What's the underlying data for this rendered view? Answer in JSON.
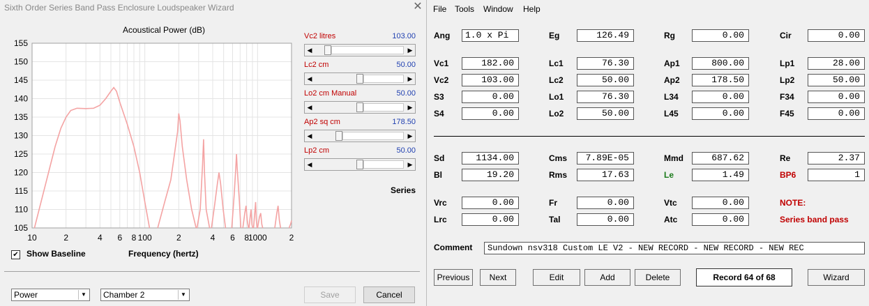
{
  "wizard": {
    "title": "Sixth Order Series Band Pass Enclosure Loudspeaker Wizard",
    "close_glyph": "✕",
    "chart_title": "Acoustical Power (dB)",
    "x_axis_label": "Frequency (hertz)",
    "sliders": [
      {
        "label": "Vc2 litres",
        "value": "103.00",
        "thumb": 0.1
      },
      {
        "label": "Lc2 cm",
        "value": "50.00",
        "thumb": 0.5
      },
      {
        "label": "Lo2 cm Manual",
        "value": "50.00",
        "thumb": 0.5
      },
      {
        "label": "Ap2 sq cm",
        "value": "178.50",
        "thumb": 0.24
      },
      {
        "label": "Lp2 cm",
        "value": "50.00",
        "thumb": 0.5
      }
    ],
    "series_label": "Series",
    "show_baseline_label": "Show Baseline",
    "show_baseline_checked": true,
    "combo_mode": "Power",
    "combo_chamber": "Chamber 2",
    "save_label": "Save",
    "cancel_label": "Cancel"
  },
  "chart_data": {
    "type": "line",
    "title": "Acoustical Power (dB)",
    "xlabel": "Frequency (hertz)",
    "ylabel": "",
    "x_scale": "log",
    "xlim": [
      10,
      2000
    ],
    "ylim": [
      105,
      155
    ],
    "yticks": [
      105,
      110,
      115,
      120,
      125,
      130,
      135,
      140,
      145,
      150,
      155
    ],
    "xtick_labels": [
      "10",
      "2",
      "4",
      "6",
      "8",
      "100",
      "2",
      "4",
      "6",
      "8",
      "1000",
      "2"
    ],
    "xtick_values": [
      10,
      20,
      40,
      60,
      80,
      100,
      200,
      400,
      600,
      800,
      1000,
      2000
    ],
    "grid": true,
    "series": [
      {
        "color": "#f4a3a3",
        "points": [
          [
            10.5,
            105
          ],
          [
            12,
            112
          ],
          [
            14,
            120
          ],
          [
            16,
            127
          ],
          [
            18,
            132
          ],
          [
            20,
            135
          ],
          [
            22,
            136.8
          ],
          [
            25,
            137.4
          ],
          [
            30,
            137.3
          ],
          [
            35,
            137.4
          ],
          [
            40,
            138.2
          ],
          [
            45,
            140
          ],
          [
            50,
            142
          ],
          [
            53,
            143
          ],
          [
            56,
            142
          ],
          [
            60,
            139
          ],
          [
            70,
            133
          ],
          [
            80,
            127
          ],
          [
            90,
            120
          ],
          [
            100,
            112
          ],
          [
            110,
            105
          ]
        ]
      },
      {
        "color": "#f4a3a3",
        "points": [
          [
            130,
            105
          ],
          [
            150,
            112
          ],
          [
            170,
            118
          ],
          [
            185,
            126
          ],
          [
            195,
            131
          ],
          [
            200,
            136
          ],
          [
            205,
            134
          ],
          [
            215,
            127
          ],
          [
            235,
            118
          ],
          [
            260,
            110
          ],
          [
            285,
            105
          ]
        ]
      },
      {
        "color": "#f4a3a3",
        "points": [
          [
            290,
            105
          ],
          [
            310,
            110
          ],
          [
            325,
            122
          ],
          [
            332,
            129
          ],
          [
            338,
            120
          ],
          [
            350,
            110
          ],
          [
            375,
            105
          ]
        ]
      },
      {
        "color": "#f4a3a3",
        "points": [
          [
            390,
            105
          ],
          [
            415,
            111
          ],
          [
            440,
            117
          ],
          [
            455,
            120
          ],
          [
            470,
            117
          ],
          [
            495,
            110
          ],
          [
            520,
            105
          ]
        ]
      },
      {
        "color": "#f4a3a3",
        "points": [
          [
            590,
            105
          ],
          [
            620,
            114
          ],
          [
            640,
            121
          ],
          [
            650,
            125
          ],
          [
            660,
            121
          ],
          [
            690,
            112
          ],
          [
            710,
            105
          ]
        ]
      },
      {
        "color": "#f4a3a3",
        "points": [
          [
            740,
            105
          ],
          [
            770,
            109
          ],
          [
            790,
            111
          ],
          [
            810,
            107
          ],
          [
            830,
            105
          ]
        ]
      },
      {
        "color": "#f4a3a3",
        "points": [
          [
            840,
            105
          ],
          [
            860,
            108
          ],
          [
            875,
            110
          ],
          [
            890,
            106
          ],
          [
            905,
            105
          ]
        ]
      },
      {
        "color": "#f4a3a3",
        "points": [
          [
            920,
            105
          ],
          [
            950,
            110
          ],
          [
            960,
            112
          ],
          [
            975,
            107
          ],
          [
            990,
            105
          ]
        ]
      },
      {
        "color": "#f4a3a3",
        "points": [
          [
            1000,
            105
          ],
          [
            1040,
            108
          ],
          [
            1065,
            109
          ],
          [
            1090,
            106
          ],
          [
            1110,
            105
          ]
        ]
      },
      {
        "color": "#f4a3a3",
        "points": [
          [
            1420,
            105
          ],
          [
            1480,
            109
          ],
          [
            1520,
            111
          ],
          [
            1560,
            107
          ],
          [
            1600,
            105
          ]
        ]
      },
      {
        "color": "#f4a3a3",
        "points": [
          [
            1900,
            105
          ],
          [
            1960,
            106
          ],
          [
            2000,
            107
          ]
        ]
      }
    ]
  },
  "main": {
    "menu": [
      "File",
      "Tools",
      "Window",
      "Help"
    ],
    "fields": [
      {
        "label": "Ang",
        "value": "1.0 x Pi",
        "align": "left"
      },
      {
        "label": "Eg",
        "value": "126.49"
      },
      {
        "label": "Rg",
        "value": "0.00"
      },
      {
        "label": "Cir",
        "value": "0.00"
      },
      {
        "label": "Vc1",
        "value": "182.00"
      },
      {
        "label": "Lc1",
        "value": "76.30"
      },
      {
        "label": "Ap1",
        "value": "800.00"
      },
      {
        "label": "Lp1",
        "value": "28.00"
      },
      {
        "label": "Vc2",
        "value": "103.00"
      },
      {
        "label": "Lc2",
        "value": "50.00"
      },
      {
        "label": "Ap2",
        "value": "178.50"
      },
      {
        "label": "Lp2",
        "value": "50.00"
      },
      {
        "label": "S3",
        "value": "0.00"
      },
      {
        "label": "Lo1",
        "value": "76.30"
      },
      {
        "label": "L34",
        "value": "0.00"
      },
      {
        "label": "F34",
        "value": "0.00"
      },
      {
        "label": "S4",
        "value": "0.00"
      },
      {
        "label": "Lo2",
        "value": "50.00"
      },
      {
        "label": "L45",
        "value": "0.00"
      },
      {
        "label": "F45",
        "value": "0.00"
      },
      {
        "label": "Sd",
        "value": "1134.00"
      },
      {
        "label": "Cms",
        "value": "7.89E-05"
      },
      {
        "label": "Mmd",
        "value": "687.62"
      },
      {
        "label": "Re",
        "value": "2.37"
      },
      {
        "label": "Bl",
        "value": "19.20"
      },
      {
        "label": "Rms",
        "value": "17.63"
      },
      {
        "label": "Le",
        "value": "1.49",
        "label_color": "#1a7a1a"
      },
      {
        "label": "BP6",
        "value": "1",
        "label_color": "#c00000"
      },
      {
        "label": "Vrc",
        "value": "0.00"
      },
      {
        "label": "Fr",
        "value": "0.00"
      },
      {
        "label": "Vtc",
        "value": "0.00"
      },
      {
        "label": "Lrc",
        "value": "0.00"
      },
      {
        "label": "Tal",
        "value": "0.00"
      },
      {
        "label": "Atc",
        "value": "0.00"
      }
    ],
    "note_label": "NOTE:",
    "note_text": "Series band pass",
    "note_color": "#c00000",
    "comment_label": "Comment",
    "comment_value": "Sundown nsv318 Custom LE V2 - NEW RECORD - NEW RECORD - NEW REC",
    "buttons": {
      "previous": "Previous",
      "next": "Next",
      "edit": "Edit",
      "add": "Add",
      "delete": "Delete",
      "wizard": "Wizard"
    },
    "record_label": "Record 64 of 68"
  }
}
